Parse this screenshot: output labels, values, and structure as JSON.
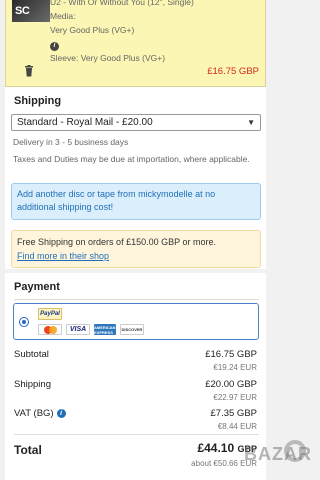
{
  "item": {
    "thumb_text": "SC",
    "line_title": "U2 - With Or Without You (12\", Single)",
    "media_label": "Media:",
    "media_value": "Very Good Plus (VG+)",
    "sleeve": "Sleeve: Very Good Plus (VG+)",
    "price": "£16.75 GBP"
  },
  "shipping": {
    "title": "Shipping",
    "selected_option": "Standard - Royal Mail - £20.00",
    "delivery": "Delivery in 3 - 5 business days",
    "duties": "Taxes and Duties may be due at importation, where applicable.",
    "promo": "Add another disc or tape from mickymodelle at no additional shipping cost!",
    "free_ship_text": "Free Shipping on orders of £150.00 GBP or more.",
    "free_ship_link": "Find more in their shop"
  },
  "payment": {
    "title": "Payment",
    "logos": [
      "PayPal",
      "VISA",
      "AMERICAN EXPRESS",
      "DISCOVER"
    ]
  },
  "totals": {
    "subtotal_label": "Subtotal",
    "subtotal_gbp": "£16.75 GBP",
    "subtotal_eur": "€19.24 EUR",
    "shipping_label": "Shipping",
    "shipping_gbp": "£20.00 GBP",
    "shipping_eur": "€22.97 EUR",
    "vat_label": "VAT (BG)",
    "vat_gbp": "£7.35 GBP",
    "vat_eur": "€8.44 EUR",
    "total_label": "Total",
    "total_amount": "£44.10",
    "total_currency": "GBP",
    "about": "about €50.66 EUR"
  },
  "watermark": "BAZAR"
}
